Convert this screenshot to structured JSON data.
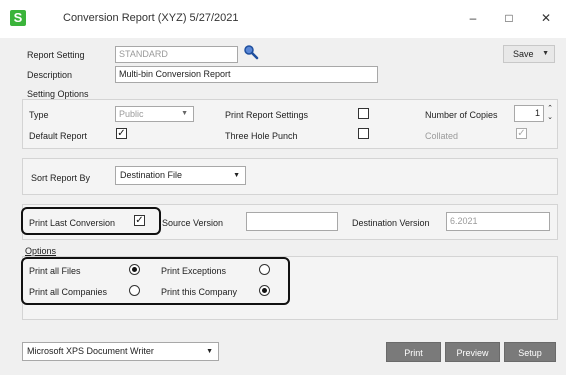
{
  "window": {
    "title": "Conversion Report (XYZ) 5/27/2021",
    "app_icon_letter": "S",
    "minimize": "–",
    "maximize": "□",
    "close": "✕"
  },
  "report_setting": {
    "label": "Report Setting",
    "value": "STANDARD"
  },
  "description": {
    "label": "Description",
    "value": "Multi-bin Conversion Report"
  },
  "save_button": {
    "label": "Save"
  },
  "setting_options": {
    "heading": "Setting Options",
    "type_label": "Type",
    "type_value": "Public",
    "default_report_label": "Default Report",
    "print_report_settings_label": "Print Report Settings",
    "three_hole_punch_label": "Three Hole Punch",
    "number_of_copies_label": "Number of Copies",
    "number_of_copies_value": "1",
    "collated_label": "Collated"
  },
  "sort": {
    "label": "Sort Report By",
    "value": "Destination File"
  },
  "conversion": {
    "print_last_label": "Print Last Conversion",
    "source_version_label": "Source Version",
    "source_version_value": "",
    "destination_version_label": "Destination Version",
    "destination_version_value": "6.2021"
  },
  "options": {
    "heading": "Options",
    "print_all_files": "Print all Files",
    "print_exceptions": "Print Exceptions",
    "print_all_companies": "Print all Companies",
    "print_this_company": "Print this Company"
  },
  "printer": {
    "value": "Microsoft XPS Document Writer"
  },
  "buttons": {
    "print": "Print",
    "preview": "Preview",
    "setup": "Setup"
  },
  "icons": {
    "search": "search-icon",
    "dropdown": "chevron-down-icon"
  }
}
